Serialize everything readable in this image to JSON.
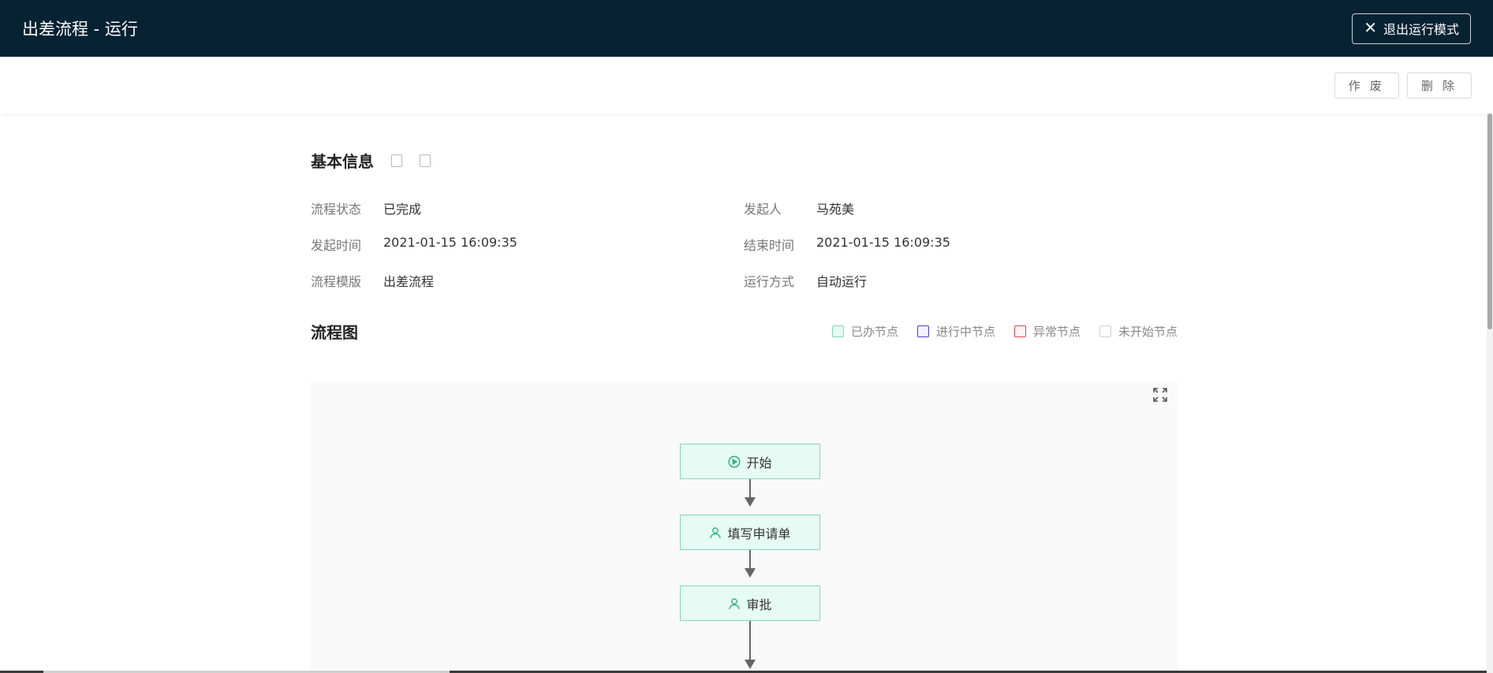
{
  "header": {
    "title": "出差流程 - 运行",
    "exit_label": "退出运行模式"
  },
  "actions": {
    "void_label": "作 废",
    "delete_label": "删 除"
  },
  "basic_info": {
    "title": "基本信息",
    "rows": [
      {
        "left_label": "流程状态",
        "left_value": "已完成",
        "right_label": "发起人",
        "right_value": "马苑美"
      },
      {
        "left_label": "发起时间",
        "left_value": "2021-01-15 16:09:35",
        "right_label": "结束时间",
        "right_value": "2021-01-15 16:09:35"
      },
      {
        "left_label": "流程模版",
        "left_value": "出差流程",
        "right_label": "运行方式",
        "right_value": "自动运行"
      }
    ]
  },
  "flow": {
    "title": "流程图",
    "legend": [
      {
        "label": "已办节点",
        "color": "#7fd9b9",
        "fill": "#e6fbf3"
      },
      {
        "label": "进行中节点",
        "color": "#4a3fd6",
        "fill": "#f4f3ff"
      },
      {
        "label": "异常节点",
        "color": "#e2454f",
        "fill": "#fff3f3"
      },
      {
        "label": "未开始节点",
        "color": "#d0d0d0",
        "fill": "#ffffff"
      }
    ],
    "nodes": [
      {
        "label": "开始",
        "icon": "play-circle-icon"
      },
      {
        "label": "填写申请单",
        "icon": "user-icon"
      },
      {
        "label": "审批",
        "icon": "user-icon"
      }
    ]
  },
  "colors": {
    "header_bg": "#062233",
    "node_done_fill": "#e6fbf3",
    "node_done_border": "#7fd9b9"
  }
}
